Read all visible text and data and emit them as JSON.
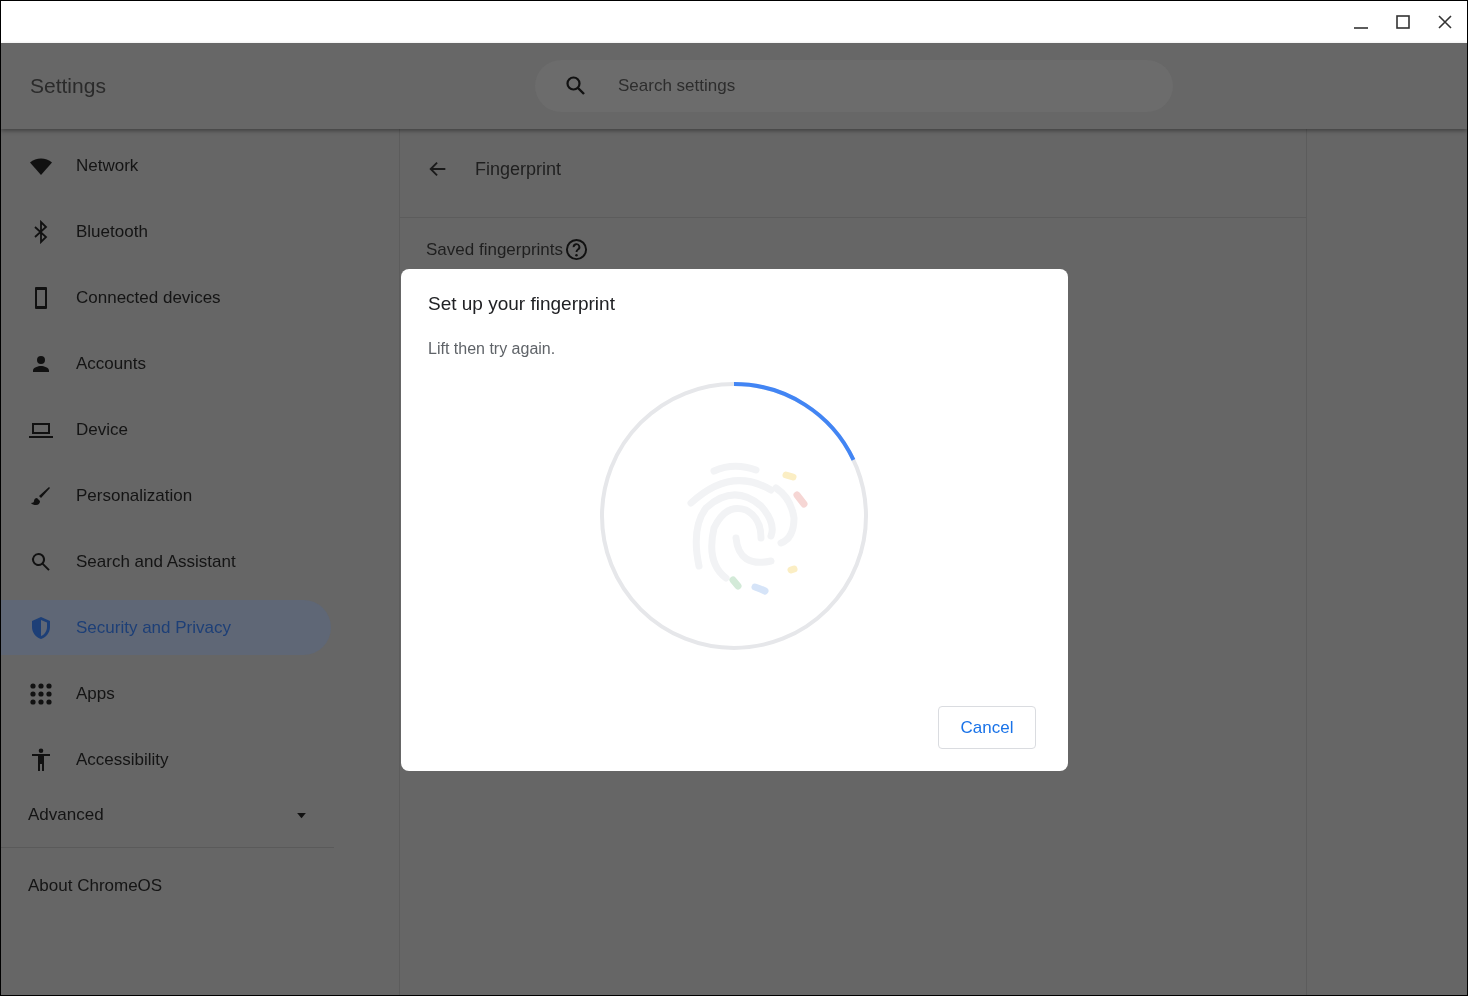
{
  "window": {
    "title": "Settings"
  },
  "search": {
    "placeholder": "Search settings"
  },
  "sidebar": {
    "items": [
      {
        "label": "Network",
        "selected": false
      },
      {
        "label": "Bluetooth",
        "selected": false
      },
      {
        "label": "Connected devices",
        "selected": false
      },
      {
        "label": "Accounts",
        "selected": false
      },
      {
        "label": "Device",
        "selected": false
      },
      {
        "label": "Personalization",
        "selected": false
      },
      {
        "label": "Search and Assistant",
        "selected": false
      },
      {
        "label": "Security and Privacy",
        "selected": true
      },
      {
        "label": "Apps",
        "selected": false
      },
      {
        "label": "Accessibility",
        "selected": false
      }
    ],
    "advanced": {
      "label": "Advanced",
      "expanded": false
    },
    "about": "About ChromeOS"
  },
  "page": {
    "title": "Fingerprint",
    "section": "Saved fingerprints"
  },
  "dialog": {
    "title": "Set up your fingerprint",
    "message": "Lift then try again.",
    "progress": {
      "level": 0.18
    },
    "buttons": [
      "Cancel"
    ]
  }
}
